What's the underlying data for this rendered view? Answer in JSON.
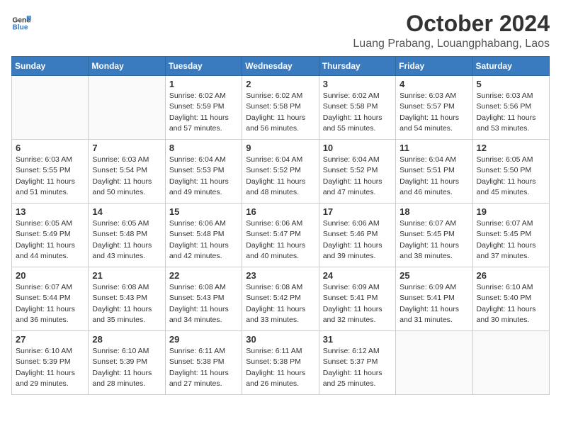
{
  "header": {
    "logo_general": "General",
    "logo_blue": "Blue",
    "month": "October 2024",
    "location": "Luang Prabang, Louangphabang, Laos"
  },
  "days_of_week": [
    "Sunday",
    "Monday",
    "Tuesday",
    "Wednesday",
    "Thursday",
    "Friday",
    "Saturday"
  ],
  "weeks": [
    [
      {
        "day": "",
        "detail": ""
      },
      {
        "day": "",
        "detail": ""
      },
      {
        "day": "1",
        "detail": "Sunrise: 6:02 AM\nSunset: 5:59 PM\nDaylight: 11 hours\nand 57 minutes."
      },
      {
        "day": "2",
        "detail": "Sunrise: 6:02 AM\nSunset: 5:58 PM\nDaylight: 11 hours\nand 56 minutes."
      },
      {
        "day": "3",
        "detail": "Sunrise: 6:02 AM\nSunset: 5:58 PM\nDaylight: 11 hours\nand 55 minutes."
      },
      {
        "day": "4",
        "detail": "Sunrise: 6:03 AM\nSunset: 5:57 PM\nDaylight: 11 hours\nand 54 minutes."
      },
      {
        "day": "5",
        "detail": "Sunrise: 6:03 AM\nSunset: 5:56 PM\nDaylight: 11 hours\nand 53 minutes."
      }
    ],
    [
      {
        "day": "6",
        "detail": "Sunrise: 6:03 AM\nSunset: 5:55 PM\nDaylight: 11 hours\nand 51 minutes."
      },
      {
        "day": "7",
        "detail": "Sunrise: 6:03 AM\nSunset: 5:54 PM\nDaylight: 11 hours\nand 50 minutes."
      },
      {
        "day": "8",
        "detail": "Sunrise: 6:04 AM\nSunset: 5:53 PM\nDaylight: 11 hours\nand 49 minutes."
      },
      {
        "day": "9",
        "detail": "Sunrise: 6:04 AM\nSunset: 5:52 PM\nDaylight: 11 hours\nand 48 minutes."
      },
      {
        "day": "10",
        "detail": "Sunrise: 6:04 AM\nSunset: 5:52 PM\nDaylight: 11 hours\nand 47 minutes."
      },
      {
        "day": "11",
        "detail": "Sunrise: 6:04 AM\nSunset: 5:51 PM\nDaylight: 11 hours\nand 46 minutes."
      },
      {
        "day": "12",
        "detail": "Sunrise: 6:05 AM\nSunset: 5:50 PM\nDaylight: 11 hours\nand 45 minutes."
      }
    ],
    [
      {
        "day": "13",
        "detail": "Sunrise: 6:05 AM\nSunset: 5:49 PM\nDaylight: 11 hours\nand 44 minutes."
      },
      {
        "day": "14",
        "detail": "Sunrise: 6:05 AM\nSunset: 5:48 PM\nDaylight: 11 hours\nand 43 minutes."
      },
      {
        "day": "15",
        "detail": "Sunrise: 6:06 AM\nSunset: 5:48 PM\nDaylight: 11 hours\nand 42 minutes."
      },
      {
        "day": "16",
        "detail": "Sunrise: 6:06 AM\nSunset: 5:47 PM\nDaylight: 11 hours\nand 40 minutes."
      },
      {
        "day": "17",
        "detail": "Sunrise: 6:06 AM\nSunset: 5:46 PM\nDaylight: 11 hours\nand 39 minutes."
      },
      {
        "day": "18",
        "detail": "Sunrise: 6:07 AM\nSunset: 5:45 PM\nDaylight: 11 hours\nand 38 minutes."
      },
      {
        "day": "19",
        "detail": "Sunrise: 6:07 AM\nSunset: 5:45 PM\nDaylight: 11 hours\nand 37 minutes."
      }
    ],
    [
      {
        "day": "20",
        "detail": "Sunrise: 6:07 AM\nSunset: 5:44 PM\nDaylight: 11 hours\nand 36 minutes."
      },
      {
        "day": "21",
        "detail": "Sunrise: 6:08 AM\nSunset: 5:43 PM\nDaylight: 11 hours\nand 35 minutes."
      },
      {
        "day": "22",
        "detail": "Sunrise: 6:08 AM\nSunset: 5:43 PM\nDaylight: 11 hours\nand 34 minutes."
      },
      {
        "day": "23",
        "detail": "Sunrise: 6:08 AM\nSunset: 5:42 PM\nDaylight: 11 hours\nand 33 minutes."
      },
      {
        "day": "24",
        "detail": "Sunrise: 6:09 AM\nSunset: 5:41 PM\nDaylight: 11 hours\nand 32 minutes."
      },
      {
        "day": "25",
        "detail": "Sunrise: 6:09 AM\nSunset: 5:41 PM\nDaylight: 11 hours\nand 31 minutes."
      },
      {
        "day": "26",
        "detail": "Sunrise: 6:10 AM\nSunset: 5:40 PM\nDaylight: 11 hours\nand 30 minutes."
      }
    ],
    [
      {
        "day": "27",
        "detail": "Sunrise: 6:10 AM\nSunset: 5:39 PM\nDaylight: 11 hours\nand 29 minutes."
      },
      {
        "day": "28",
        "detail": "Sunrise: 6:10 AM\nSunset: 5:39 PM\nDaylight: 11 hours\nand 28 minutes."
      },
      {
        "day": "29",
        "detail": "Sunrise: 6:11 AM\nSunset: 5:38 PM\nDaylight: 11 hours\nand 27 minutes."
      },
      {
        "day": "30",
        "detail": "Sunrise: 6:11 AM\nSunset: 5:38 PM\nDaylight: 11 hours\nand 26 minutes."
      },
      {
        "day": "31",
        "detail": "Sunrise: 6:12 AM\nSunset: 5:37 PM\nDaylight: 11 hours\nand 25 minutes."
      },
      {
        "day": "",
        "detail": ""
      },
      {
        "day": "",
        "detail": ""
      }
    ]
  ]
}
